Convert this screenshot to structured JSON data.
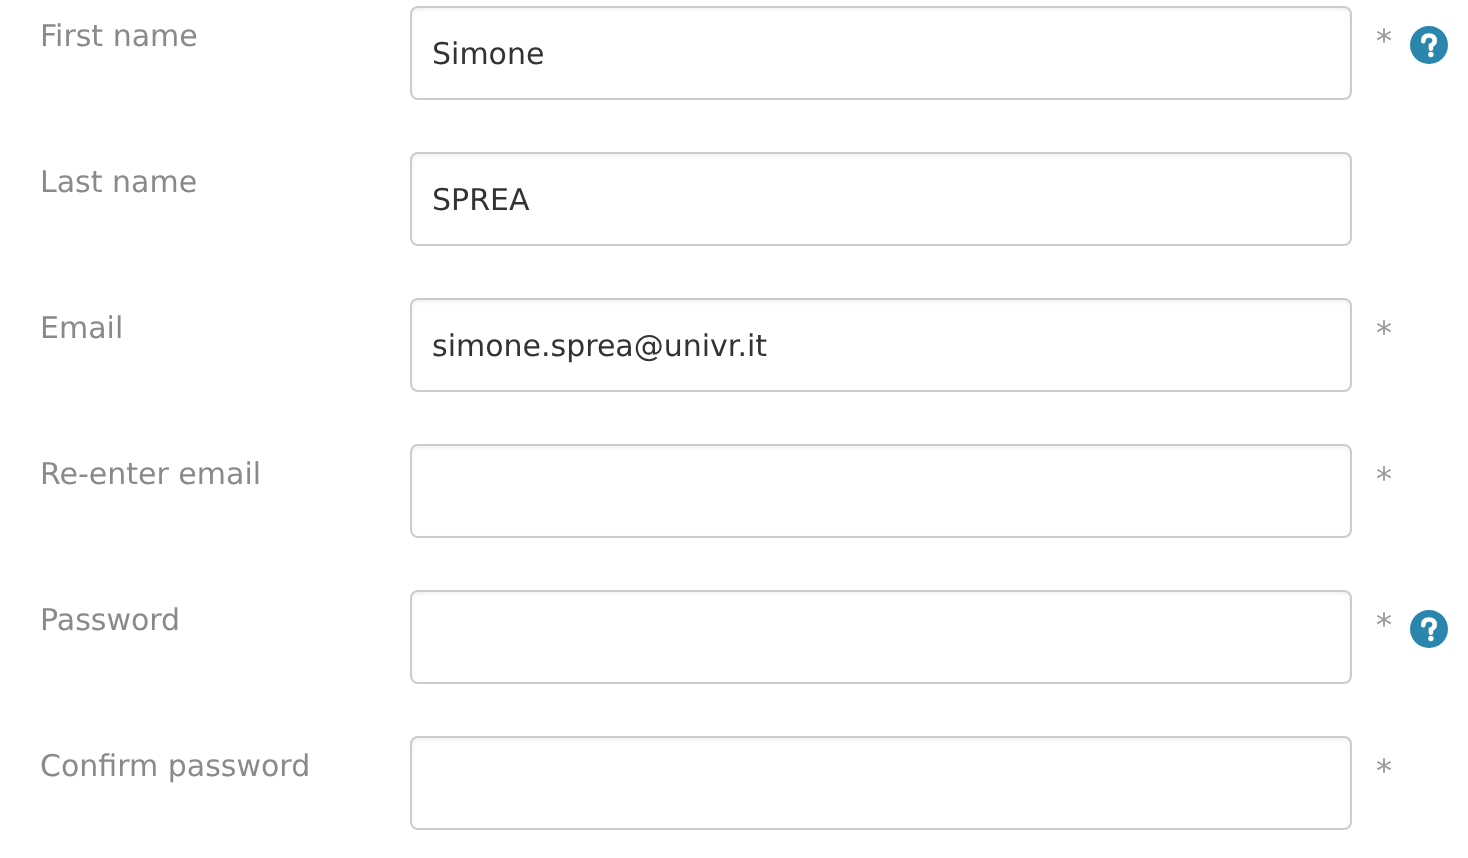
{
  "sections": [
    {
      "fields": [
        {
          "label": "First name",
          "value": "Simone",
          "required_mark": "*",
          "help": true
        },
        {
          "label": "Last name",
          "value": "SPREA",
          "help": false
        },
        {
          "label": "Email",
          "value": "simone.sprea@univr.it",
          "required_mark": "*",
          "help": false
        },
        {
          "label": "Re-enter email",
          "required_mark": "*",
          "help": false
        }
      ]
    },
    {
      "fields": [
        {
          "label": "Password",
          "required_mark": "*",
          "help": true
        },
        {
          "label": "Confirm password",
          "required_mark": "*",
          "help": false
        }
      ]
    }
  ]
}
